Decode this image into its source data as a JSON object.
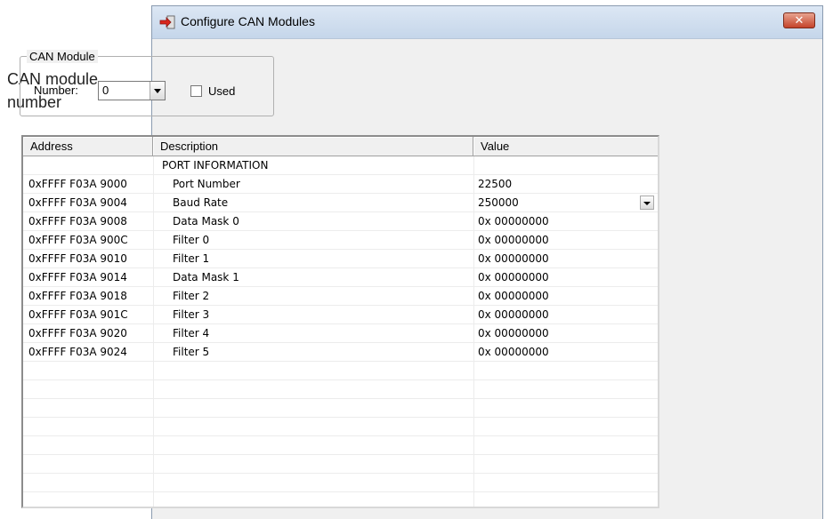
{
  "annotation": {
    "line1": "CAN module",
    "line2": "number"
  },
  "window": {
    "title": "Configure CAN Modules",
    "close_label": "✕"
  },
  "can_module": {
    "group_label": "CAN Module",
    "number_label": "Number:",
    "number_value": "0",
    "used_label": "Used",
    "used_checked": false
  },
  "table": {
    "columns": [
      "Address",
      "Description",
      "Value"
    ],
    "rows": [
      {
        "address": "",
        "description": "PORT INFORMATION",
        "value": "",
        "indent": false,
        "dropdown": false
      },
      {
        "address": "0xFFFF F03A 9000",
        "description": "Port Number",
        "value": "22500",
        "indent": true,
        "dropdown": false
      },
      {
        "address": "0xFFFF F03A 9004",
        "description": "Baud Rate",
        "value": "250000",
        "indent": true,
        "dropdown": true
      },
      {
        "address": "0xFFFF F03A 9008",
        "description": "Data Mask 0",
        "value": "0x 00000000",
        "indent": true,
        "dropdown": false
      },
      {
        "address": "0xFFFF F03A 900C",
        "description": "Filter 0",
        "value": "0x 00000000",
        "indent": true,
        "dropdown": false
      },
      {
        "address": "0xFFFF F03A 9010",
        "description": "Filter 1",
        "value": "0x 00000000",
        "indent": true,
        "dropdown": false
      },
      {
        "address": "0xFFFF F03A 9014",
        "description": "Data Mask 1",
        "value": "0x 00000000",
        "indent": true,
        "dropdown": false
      },
      {
        "address": "0xFFFF F03A 9018",
        "description": "Filter 2",
        "value": "0x 00000000",
        "indent": true,
        "dropdown": false
      },
      {
        "address": "0xFFFF F03A 901C",
        "description": "Filter 3",
        "value": "0x 00000000",
        "indent": true,
        "dropdown": false
      },
      {
        "address": "0xFFFF F03A 9020",
        "description": "Filter 4",
        "value": "0x 00000000",
        "indent": true,
        "dropdown": false
      },
      {
        "address": "0xFFFF F03A 9024",
        "description": "Filter 5",
        "value": "0x 00000000",
        "indent": true,
        "dropdown": false
      }
    ]
  }
}
